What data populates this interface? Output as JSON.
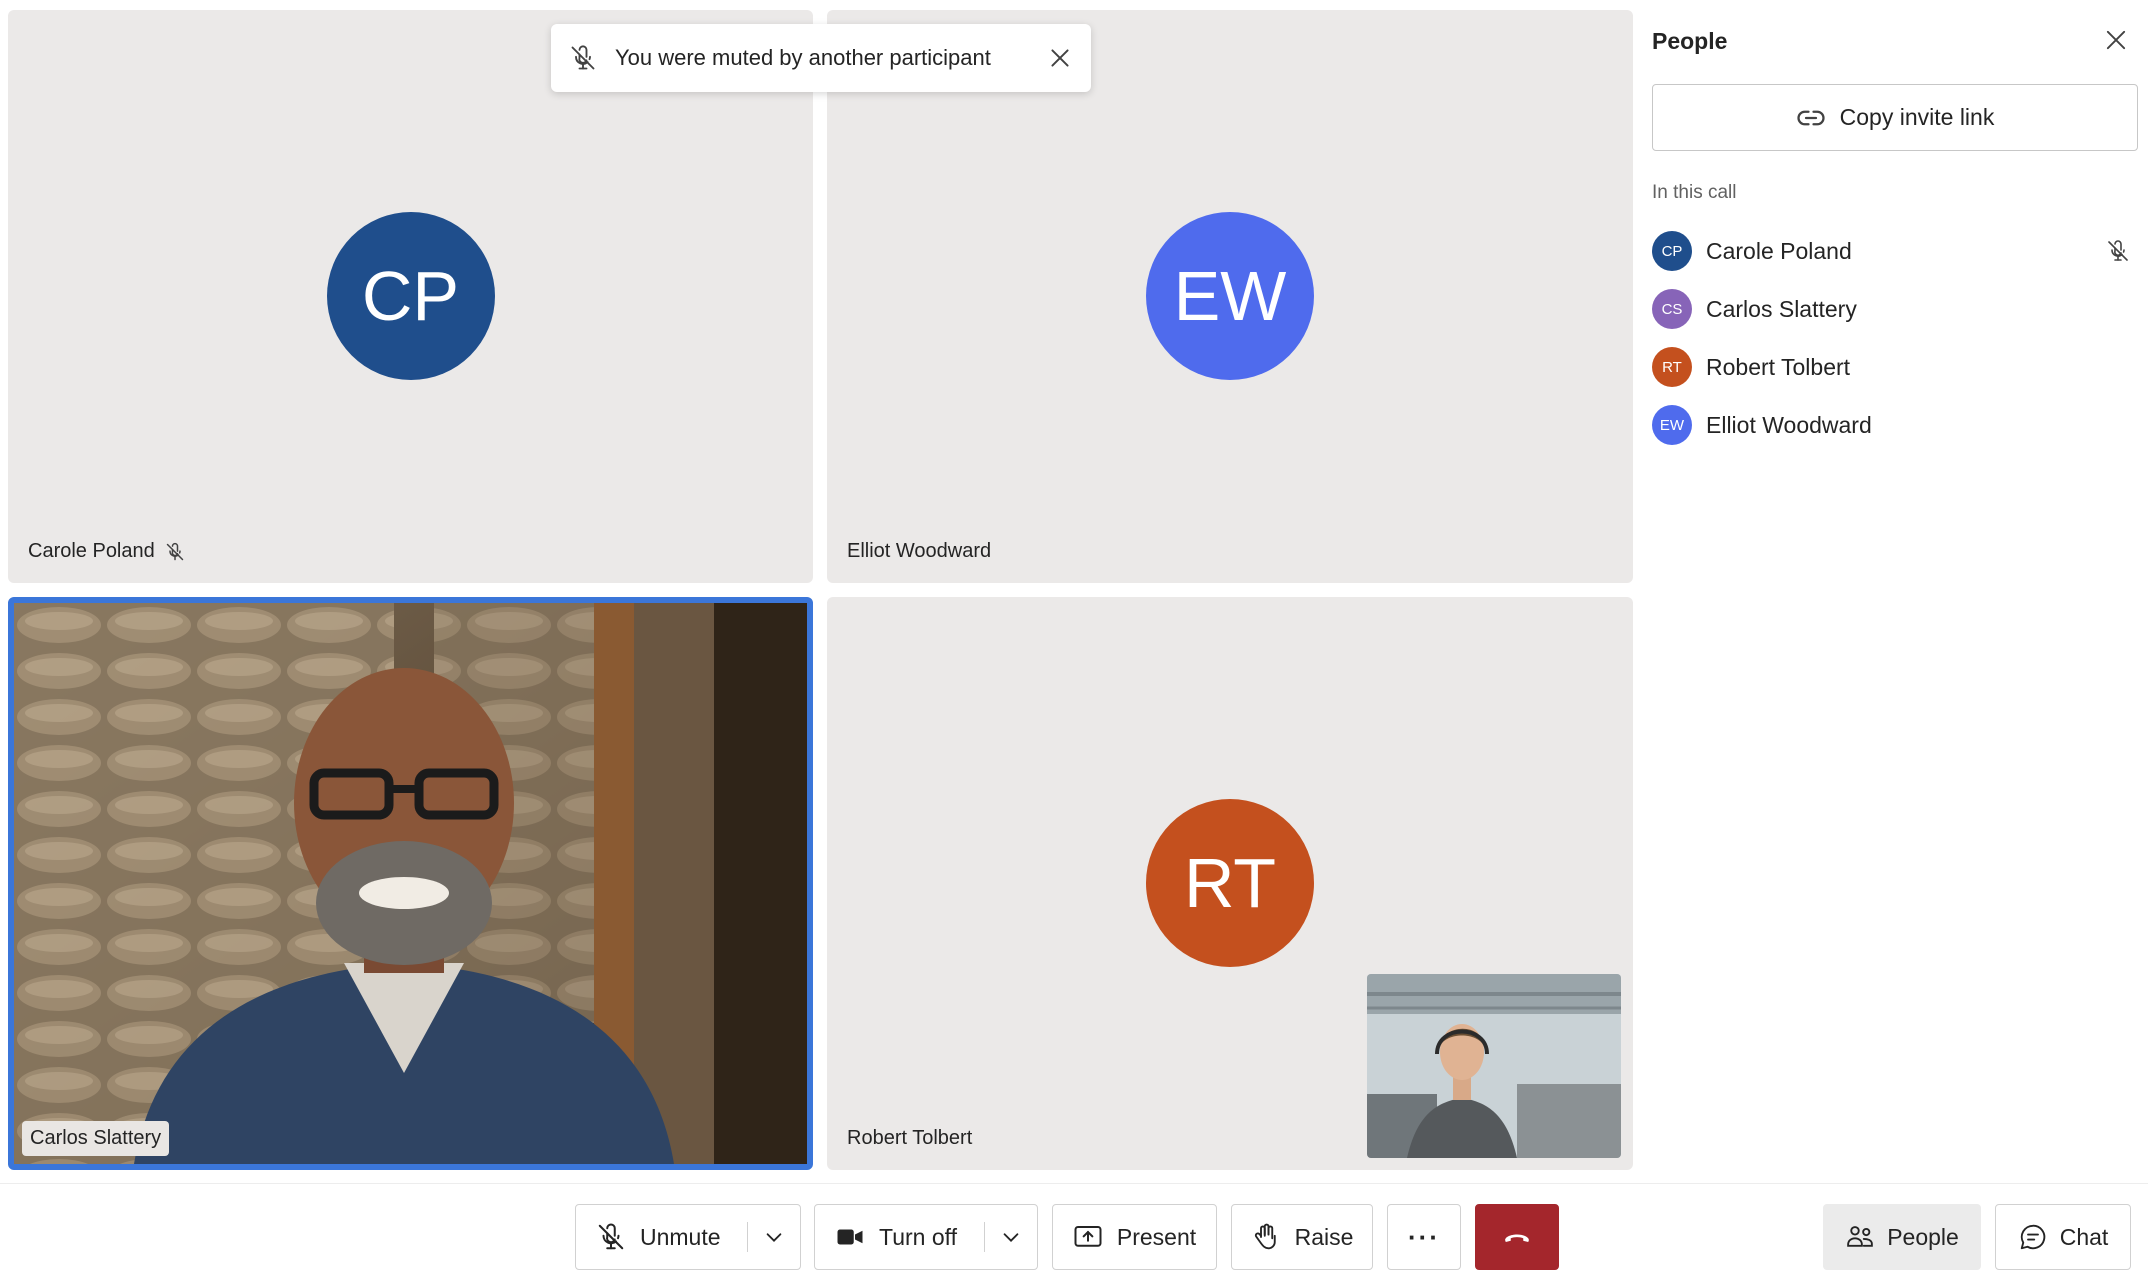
{
  "colors": {
    "accent_blue": "#3b76d9",
    "leave_red": "#a4262c",
    "tile_bg": "#ebe9e8"
  },
  "toast": {
    "message": "You were muted by another participant",
    "icon": "mic-off-icon",
    "close_icon": "close-icon"
  },
  "tiles": [
    {
      "initials": "CP",
      "name": "Carole Poland",
      "avatar_color": "#1f4e8c",
      "muted": true
    },
    {
      "initials": "EW",
      "name": "Elliot Woodward",
      "avatar_color": "#4f6bed",
      "muted": false
    },
    {
      "name": "Carlos Slattery",
      "video": true,
      "active_speaker": true
    },
    {
      "initials": "RT",
      "name": "Robert Tolbert",
      "avatar_color": "#c4501e",
      "muted": false
    }
  ],
  "panel": {
    "title": "People",
    "invite_label": "Copy invite link",
    "section_label": "In this call",
    "people": [
      {
        "initials": "CP",
        "name": "Carole Poland",
        "avatar_color": "#1f4e8c",
        "muted": true
      },
      {
        "initials": "CS",
        "name": "Carlos Slattery",
        "avatar_color": "#8764b8",
        "muted": false
      },
      {
        "initials": "RT",
        "name": "Robert Tolbert",
        "avatar_color": "#c4501e",
        "muted": false
      },
      {
        "initials": "EW",
        "name": "Elliot Woodward",
        "avatar_color": "#4f6bed",
        "muted": false
      }
    ]
  },
  "controls": {
    "unmute": "Unmute",
    "turn_off": "Turn off",
    "present": "Present",
    "raise": "Raise",
    "more": "···",
    "people": "People",
    "chat": "Chat"
  }
}
